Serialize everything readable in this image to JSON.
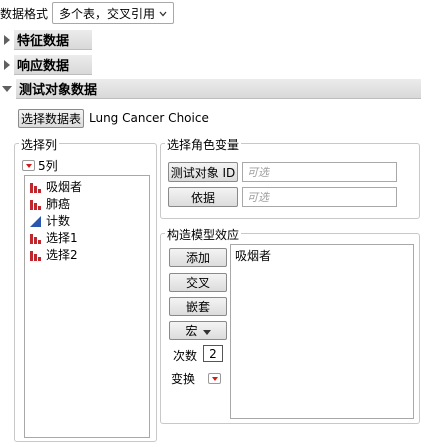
{
  "format": {
    "label": "数据格式",
    "value": "多个表，交叉引用"
  },
  "sections": {
    "features": "特征数据",
    "responses": "响应数据",
    "test_subject": "测试对象数据"
  },
  "select_table": {
    "button": "选择数据表",
    "table_name": "Lung Cancer Choice"
  },
  "select_columns": {
    "title": "选择列",
    "count": "5列",
    "columns": [
      {
        "name": "吸烟者",
        "icon": "nominal-bar-icon"
      },
      {
        "name": "肺癌",
        "icon": "nominal-bar-icon"
      },
      {
        "name": "计数",
        "icon": "continuous-triangle-icon"
      },
      {
        "name": "选择1",
        "icon": "nominal-bar-icon"
      },
      {
        "name": "选择2",
        "icon": "nominal-bar-icon"
      }
    ]
  },
  "roles": {
    "title": "选择角色变量",
    "subject_id_button": "测试对象 ID",
    "subject_id_placeholder": "可选",
    "by_button": "依据",
    "by_placeholder": "可选"
  },
  "model_effects": {
    "title": "构造模型效应",
    "add": "添加",
    "cross": "交叉",
    "nest": "嵌套",
    "macros": "宏",
    "degree_label": "次数",
    "degree_value": "2",
    "transform_label": "变换",
    "effects": [
      "吸烟者"
    ]
  },
  "colors": {
    "nominal_icon": "#c0272d",
    "continuous_icon": "#2a56b0",
    "red_arrow": "#d21b1b"
  }
}
